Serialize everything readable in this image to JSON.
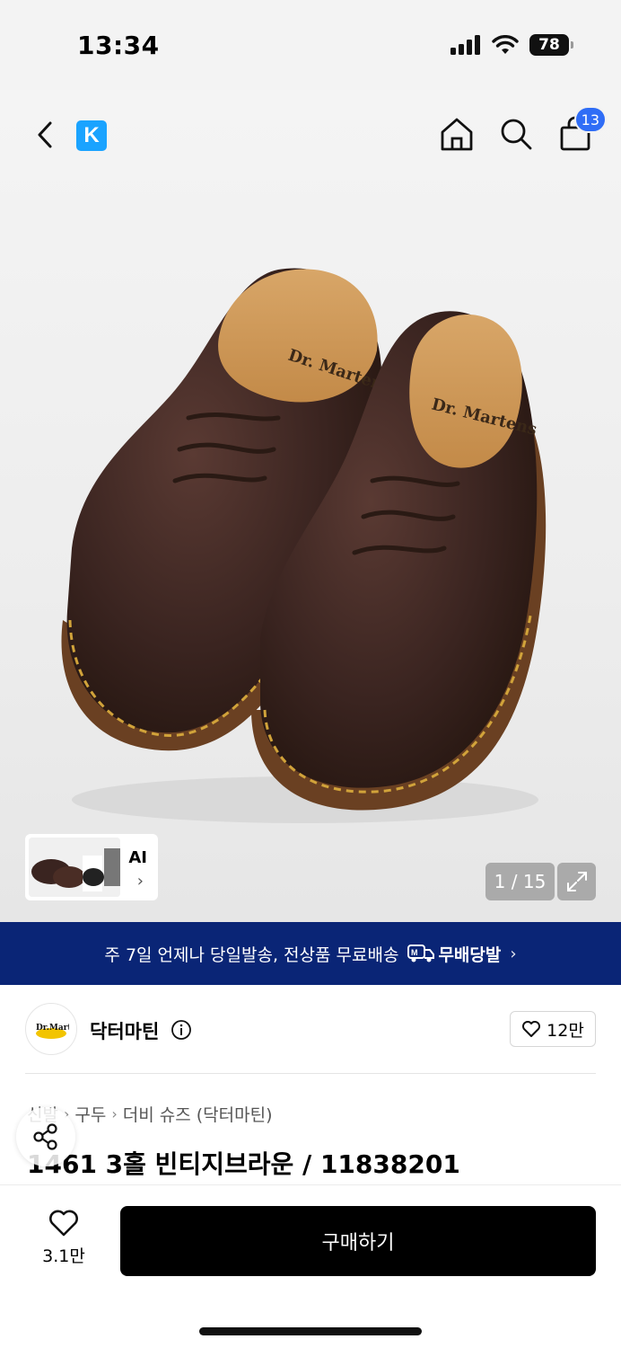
{
  "status_bar": {
    "time": "13:34",
    "battery": "78"
  },
  "nav": {
    "brand_badge": "K",
    "cart_count": "13"
  },
  "gallery": {
    "ai_label": "AI",
    "pager": "1 / 15"
  },
  "banner": {
    "text": "주 7일 언제나 당일발송, 전상품 무료배송",
    "badge": "무배당발"
  },
  "brand": {
    "name": "닥터마틴",
    "likes": "12만"
  },
  "breadcrumb": [
    "신발",
    "구두",
    "더비 슈즈 (닥터마틴)"
  ],
  "product": {
    "title": "1461 3홀 빈티지브라운 / 11838201"
  },
  "bottom": {
    "wish_count": "3.1만",
    "buy_label": "구매하기"
  },
  "colors": {
    "banner_bg": "#0a2576",
    "badge_blue": "#2f6df6",
    "brand_k": "#1aa3ff",
    "buy_bg": "#000000"
  }
}
